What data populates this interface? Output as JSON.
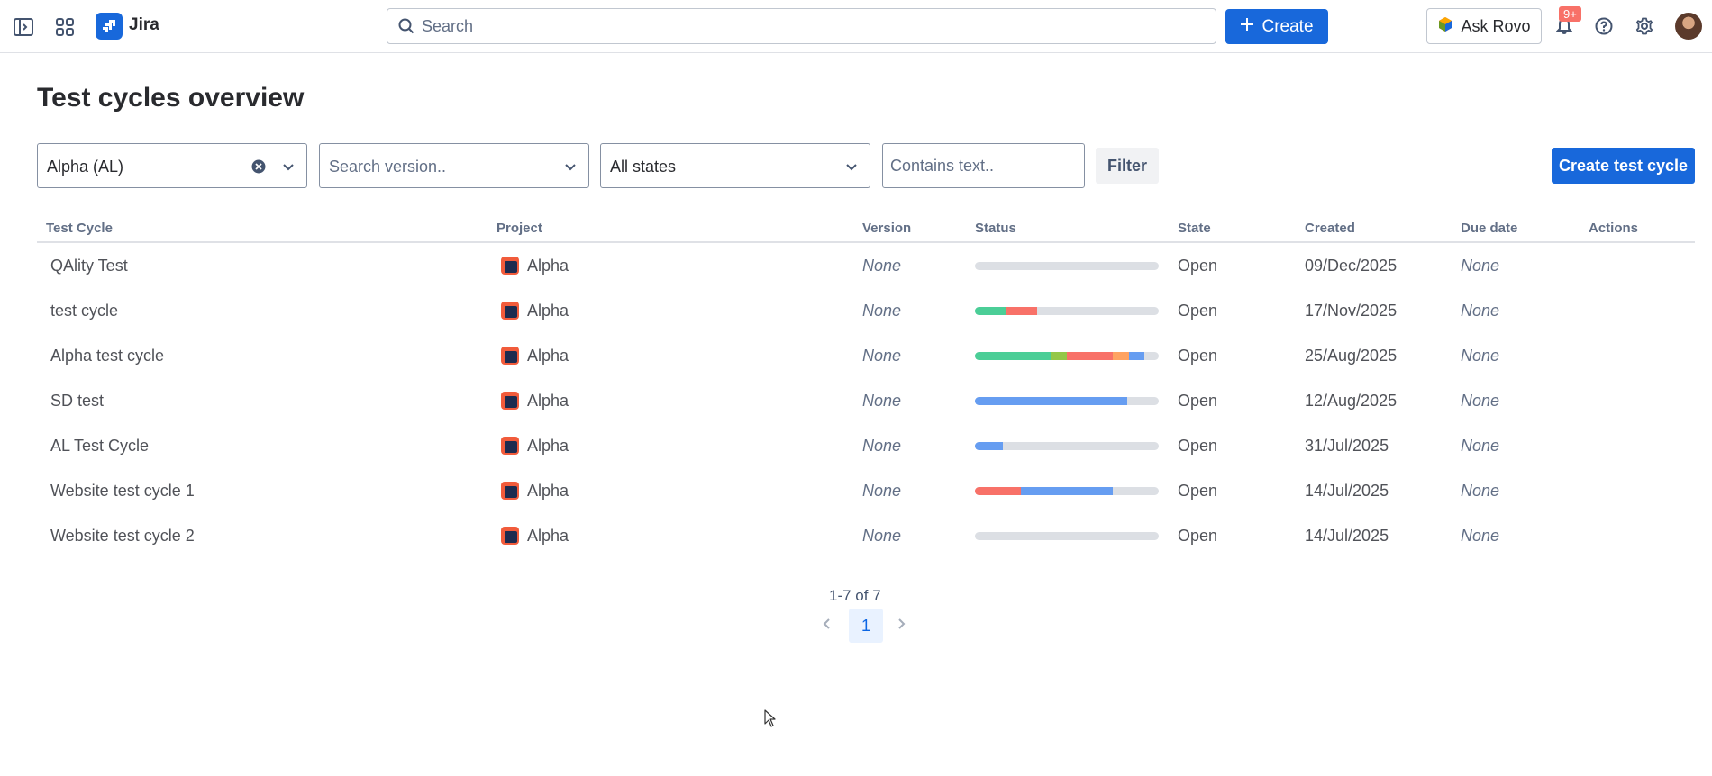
{
  "header": {
    "app_name": "Jira",
    "search_placeholder": "Search",
    "create_label": "Create",
    "ask_rovo_label": "Ask Rovo",
    "notification_badge": "9+",
    "icons": [
      "sidebar-toggle-icon",
      "app-switcher-icon",
      "search-icon",
      "plus-icon",
      "rovo-icon",
      "bell-icon",
      "help-icon",
      "gear-icon"
    ],
    "brand_color": "#1868db"
  },
  "page": {
    "title": "Test cycles overview"
  },
  "filters": {
    "project_value": "Alpha (AL)",
    "version_placeholder": "Search version..",
    "state_value": "All states",
    "text_placeholder": "Contains text..",
    "filter_label": "Filter",
    "create_cycle_label": "Create test cycle"
  },
  "table": {
    "columns": [
      "Test Cycle",
      "Project",
      "Version",
      "Status",
      "State",
      "Created",
      "Due date",
      "Actions"
    ],
    "status_colors": {
      "passed": "#4bce97",
      "passed_dim": "#94c748",
      "failed": "#f87168",
      "blocked": "#fea362",
      "in_progress": "#669df1",
      "not_run": "#dcdfe4"
    },
    "rows": [
      {
        "name": "QAlity Test",
        "project": "Alpha",
        "version": "None",
        "state": "Open",
        "created": "09/Dec/2025",
        "due": "None",
        "status": []
      },
      {
        "name": "test cycle",
        "project": "Alpha",
        "version": "None",
        "state": "Open",
        "created": "17/Nov/2025",
        "due": "None",
        "status": [
          {
            "key": "passed",
            "fraction": 0.17
          },
          {
            "key": "failed",
            "fraction": 0.17
          }
        ]
      },
      {
        "name": "Alpha test cycle",
        "project": "Alpha",
        "version": "None",
        "state": "Open",
        "created": "25/Aug/2025",
        "due": "None",
        "status": [
          {
            "key": "passed",
            "fraction": 0.41
          },
          {
            "key": "passed_dim",
            "fraction": 0.09
          },
          {
            "key": "failed",
            "fraction": 0.25
          },
          {
            "key": "blocked",
            "fraction": 0.09
          },
          {
            "key": "in_progress",
            "fraction": 0.08
          }
        ]
      },
      {
        "name": "SD test",
        "project": "Alpha",
        "version": "None",
        "state": "Open",
        "created": "12/Aug/2025",
        "due": "None",
        "status": [
          {
            "key": "in_progress",
            "fraction": 0.83
          }
        ]
      },
      {
        "name": "AL Test Cycle",
        "project": "Alpha",
        "version": "None",
        "state": "Open",
        "created": "31/Jul/2025",
        "due": "None",
        "status": [
          {
            "key": "in_progress",
            "fraction": 0.15
          }
        ]
      },
      {
        "name": "Website test cycle 1",
        "project": "Alpha",
        "version": "None",
        "state": "Open",
        "created": "14/Jul/2025",
        "due": "None",
        "status": [
          {
            "key": "failed",
            "fraction": 0.25
          },
          {
            "key": "in_progress",
            "fraction": 0.5
          }
        ]
      },
      {
        "name": "Website test cycle 2",
        "project": "Alpha",
        "version": "None",
        "state": "Open",
        "created": "14/Jul/2025",
        "due": "None",
        "status": []
      }
    ]
  },
  "pagination": {
    "summary": "1-7 of 7",
    "current_page": "1"
  }
}
